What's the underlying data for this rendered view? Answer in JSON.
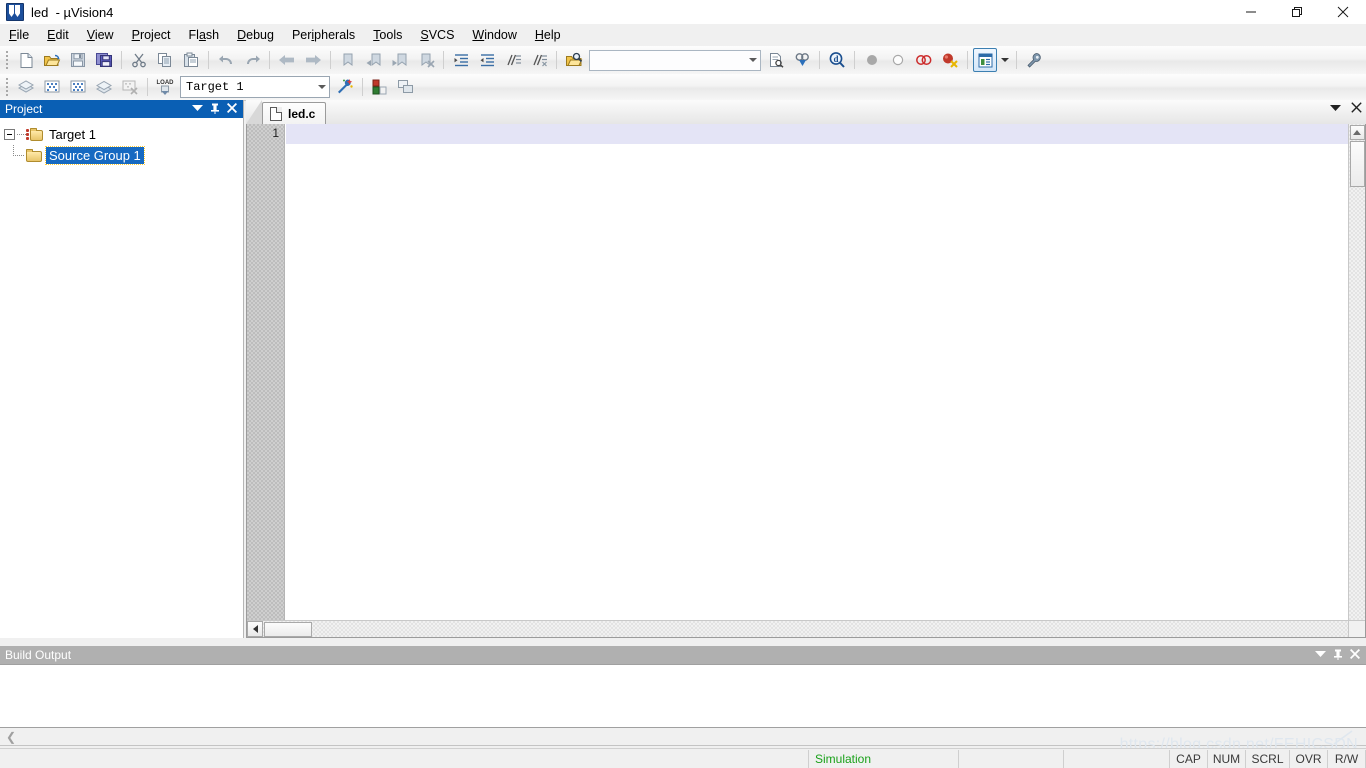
{
  "window": {
    "title": "led  - µVision4",
    "app_icon": "uvision-logo-icon",
    "minimize_label": "Minimize",
    "restore_label": "Restore",
    "close_label": "Close"
  },
  "menubar": {
    "items": [
      {
        "label": "File",
        "accel": "F"
      },
      {
        "label": "Edit",
        "accel": "E"
      },
      {
        "label": "View",
        "accel": "V"
      },
      {
        "label": "Project",
        "accel": "P"
      },
      {
        "label": "Flash",
        "accel": "a"
      },
      {
        "label": "Debug",
        "accel": "D"
      },
      {
        "label": "Peripherals",
        "accel": "i"
      },
      {
        "label": "Tools",
        "accel": "T"
      },
      {
        "label": "SVCS",
        "accel": "S"
      },
      {
        "label": "Window",
        "accel": "W"
      },
      {
        "label": "Help",
        "accel": "H"
      }
    ]
  },
  "toolbar_file": {
    "buttons": [
      {
        "name": "new-file-icon",
        "tip": "New"
      },
      {
        "name": "open-file-icon",
        "tip": "Open"
      },
      {
        "name": "save-icon",
        "tip": "Save"
      },
      {
        "name": "save-all-icon",
        "tip": "Save All"
      },
      {
        "name": "cut-icon",
        "tip": "Cut"
      },
      {
        "name": "copy-icon",
        "tip": "Copy"
      },
      {
        "name": "paste-icon",
        "tip": "Paste"
      },
      {
        "name": "undo-icon",
        "tip": "Undo"
      },
      {
        "name": "redo-icon",
        "tip": "Redo"
      },
      {
        "name": "navigate-back-icon",
        "tip": "Back"
      },
      {
        "name": "navigate-forward-icon",
        "tip": "Forward"
      },
      {
        "name": "bookmark-toggle-icon",
        "tip": "Insert/Remove Bookmark"
      },
      {
        "name": "bookmark-prev-icon",
        "tip": "Previous Bookmark"
      },
      {
        "name": "bookmark-next-icon",
        "tip": "Next Bookmark"
      },
      {
        "name": "bookmark-clear-icon",
        "tip": "Clear All Bookmarks"
      },
      {
        "name": "indent-icon",
        "tip": "Indent Selected Text"
      },
      {
        "name": "outdent-icon",
        "tip": "Unindent Selected Text"
      },
      {
        "name": "comment-icon",
        "tip": "Comment Selection"
      },
      {
        "name": "uncomment-icon",
        "tip": "Uncomment Selection"
      },
      {
        "name": "find-in-files-icon",
        "tip": "Find in Files"
      },
      {
        "name": "find-icon",
        "tip": "Find"
      },
      {
        "name": "incremental-find-icon",
        "tip": "Incremental Find"
      },
      {
        "name": "find-symbol-icon",
        "tip": "Find in Files"
      },
      {
        "name": "breakpoint-insert-icon",
        "tip": "Insert/Remove Breakpoint"
      },
      {
        "name": "breakpoint-enable-icon",
        "tip": "Enable/Disable Breakpoint"
      },
      {
        "name": "breakpoint-disable-all-icon",
        "tip": "Disable All Breakpoints"
      },
      {
        "name": "breakpoint-kill-all-icon",
        "tip": "Kill All Breakpoints"
      },
      {
        "name": "manage-windows-icon",
        "tip": "Manage Windows and Toolbars"
      },
      {
        "name": "configuration-wizard-icon",
        "tip": "Configuration Wizard"
      }
    ],
    "find_combo_value": "",
    "find_combo_placeholder": ""
  },
  "toolbar_build": {
    "buttons": [
      {
        "name": "translate-icon",
        "tip": "Translate current file"
      },
      {
        "name": "build-icon",
        "tip": "Build target"
      },
      {
        "name": "rebuild-icon",
        "tip": "Rebuild all target files"
      },
      {
        "name": "batch-build-icon",
        "tip": "Batch Build"
      },
      {
        "name": "stop-build-icon",
        "tip": "Stop build"
      },
      {
        "name": "download-icon",
        "tip": "Download",
        "label": "LOAD"
      },
      {
        "name": "target-options-icon",
        "tip": "Options for Target"
      },
      {
        "name": "manage-components-icon",
        "tip": "Manage Components"
      },
      {
        "name": "multi-project-icon",
        "tip": "Manage Multi-Project"
      }
    ],
    "target_select_value": "Target 1"
  },
  "project_panel": {
    "title": "Project",
    "dropdown_icon": "chevron-down-icon",
    "pin_icon": "pin-icon",
    "close_icon": "close-icon",
    "tree": {
      "root": {
        "label": "Target 1",
        "icon": "target-folder-icon",
        "expanded": true,
        "children": [
          {
            "label": "Source Group 1",
            "icon": "folder-icon",
            "selected": true
          }
        ]
      }
    }
  },
  "editor": {
    "tabs": [
      {
        "label": "led.c",
        "icon": "document-icon",
        "active": true
      }
    ],
    "dropdown_icon": "chevron-down-icon",
    "close_icon": "close-icon",
    "line_numbers": [
      "1"
    ],
    "content_lines": [
      ""
    ],
    "current_line": 1,
    "hscroll_left_icon": "arrow-left-icon",
    "vscroll_up_icon": "arrow-up-icon",
    "vscroll_down_icon": "arrow-down-icon"
  },
  "build_output": {
    "title": "Build Output",
    "dropdown_icon": "chevron-down-icon",
    "pin_icon": "pin-icon",
    "close_icon": "close-icon",
    "content": "",
    "tab_scroll_left_icon": "chevron-left-icon"
  },
  "statusbar": {
    "message": "",
    "mode": "Simulation",
    "field_2": "",
    "field_3": "",
    "indicators": [
      "CAP",
      "NUM",
      "SCRL",
      "OVR",
      "R/W"
    ]
  },
  "watermark": {
    "text": "https://blog.csdn.net/FEHICSDN"
  },
  "colors": {
    "panel_title_active": "#0a5fb4",
    "panel_title_inactive": "#b0b0b0",
    "selection_blue": "#1669c1",
    "current_line": "#e4e4f6",
    "status_mode_green": "#1aa11a",
    "toolbar_active_border": "#3c7fb1"
  }
}
